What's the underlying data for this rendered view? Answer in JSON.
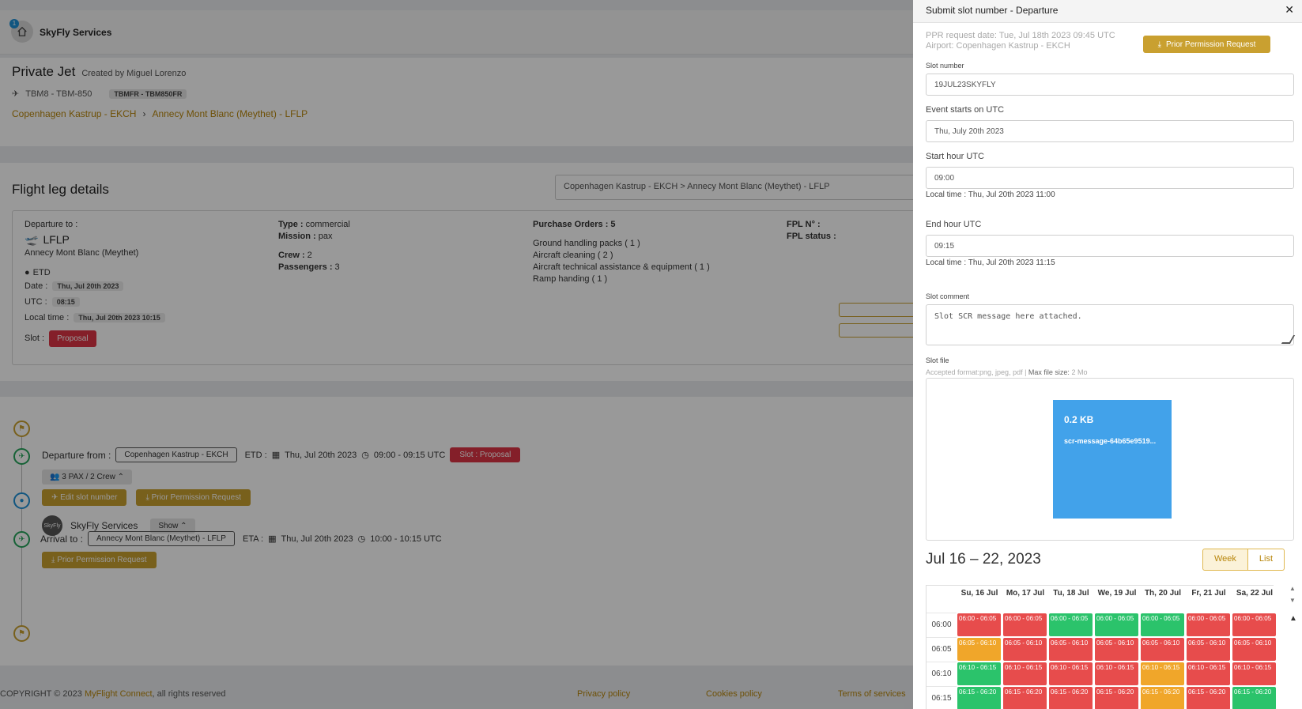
{
  "header": {
    "notification_count": "1",
    "company": "SkyFly Services"
  },
  "job": {
    "title": "Private Jet",
    "created_by": "Created by Miguel Lorenzo",
    "aircraft": "TBM8 - TBM-850",
    "registration": "TBMFR - TBM850FR",
    "route_from": "Copenhagen Kastrup - EKCH",
    "route_sep": "›",
    "route_to": "Annecy Mont Blanc (Meythet) - LFLP"
  },
  "leg": {
    "title": "Flight leg details",
    "selector": "Copenhagen Kastrup - EKCH > Annecy Mont Blanc (Meythet) - LFLP",
    "departure_label": "Departure to :",
    "departure_icao": "LFLP",
    "departure_name": "Annecy Mont Blanc (Meythet)",
    "etd_label": "ETD",
    "date_label": "Date :",
    "date_value": "Thu, Jul 20th 2023",
    "utc_label": "UTC :",
    "utc_value": "08:15",
    "local_label": "Local time :",
    "local_value": "Thu, Jul 20th 2023 10:15",
    "slot_label": "Slot :",
    "slot_value": "Proposal",
    "type_label": "Type :",
    "type_value": " commercial",
    "mission_label": "Mission :",
    "mission_value": " pax",
    "crew_label": "Crew :",
    "crew_value": " 2",
    "pax_label": "Passengers :",
    "pax_value": " 3",
    "po_label": "Purchase Orders : 5",
    "po_items": [
      "Ground handling packs ( 1 )",
      "Aircraft cleaning ( 2 )",
      "Aircraft technical assistance & equipment ( 1 )",
      "Ramp handing ( 1 )"
    ],
    "fpl_label": "FPL N° :",
    "fpl_status_label": "FPL status :"
  },
  "timeline": {
    "departure_label": "Departure from :",
    "departure_airport": "Copenhagen Kastrup - EKCH",
    "etd_text": "ETD :",
    "etd_date": "Thu, Jul 20th 2023",
    "etd_time": "09:00 - 09:15 UTC",
    "slot_badge": "Slot : Proposal",
    "pax_crew": "3 PAX  /  2 Crew",
    "edit_slot": "Edit slot number",
    "ppr_btn": "Prior Permission Request",
    "handler_avatar": "SkyFly",
    "handler_name": "SkyFly Services",
    "show_btn": "Show",
    "arrival_label": "Arrival to :",
    "arrival_airport": "Annecy Mont Blanc (Meythet) - LFLP",
    "eta_text": "ETA :",
    "eta_date": "Thu, Jul 20th 2023",
    "eta_time": "10:00 - 10:15 UTC",
    "ppr_btn2": "Prior Permission Request"
  },
  "footer": {
    "copyright_pre": "COPYRIGHT © 2023 ",
    "brand": "MyFlight Connect",
    "copyright_post": ", all rights reserved",
    "privacy": "Privacy policy",
    "cookies": "Cookies policy",
    "terms": "Terms of services"
  },
  "panel": {
    "title": "Submit slot number - Departure",
    "ppr_date": "PPR request date: Tue, Jul 18th 2023 09:45 UTC",
    "airport": "Airport: Copenhagen Kastrup - EKCH",
    "ppr_button": "Prior Permission Request",
    "slot_number_label": "Slot number",
    "slot_number_value": "19JUL23SKYFLY",
    "event_label": "Event starts on UTC",
    "event_value": "Thu, July 20th 2023",
    "start_label": "Start hour UTC",
    "start_value": "09:00",
    "start_local": "Local time : Thu, Jul 20th 2023 11:00",
    "end_label": "End hour UTC",
    "end_value": "09:15",
    "end_local": "Local time : Thu, Jul 20th 2023 11:15",
    "comment_label": "Slot comment",
    "comment_value": "Slot SCR message here attached.",
    "file_label": "Slot file",
    "accepted_pre": "Accepted format:png, jpeg, pdf | ",
    "accepted_max": "Max file size:",
    "accepted_size": " 2 Mo",
    "file_size": "0.2 KB",
    "file_name": "scr-message-64b65e9519..."
  },
  "calendar": {
    "title": "Jul 16 – 22, 2023",
    "week_btn": "Week",
    "list_btn": "List",
    "days": [
      "Su, 16 Jul",
      "Mo, 17 Jul",
      "Tu, 18 Jul",
      "We, 19 Jul",
      "Th, 20 Jul",
      "Fr, 21 Jul",
      "Sa, 22 Jul"
    ],
    "times": [
      "06:00",
      "06:05",
      "06:10",
      "06:15"
    ],
    "rows": [
      {
        "label": "06:00 - 06:05",
        "status": [
          "red",
          "red",
          "green",
          "green",
          "green",
          "red",
          "red"
        ]
      },
      {
        "label": "06:05 - 06:10",
        "status": [
          "orange",
          "red",
          "red",
          "red",
          "red",
          "red",
          "red"
        ]
      },
      {
        "label": "06:10 - 06:15",
        "status": [
          "green",
          "red",
          "red",
          "red",
          "orange",
          "red",
          "red"
        ]
      },
      {
        "label": "06:15 - 06:20",
        "status": [
          "green",
          "red",
          "red",
          "red",
          "orange",
          "red",
          "green"
        ]
      }
    ],
    "colors": {
      "red": "#e74c4c",
      "green": "#2bc36b",
      "orange": "#f0a62a"
    }
  }
}
